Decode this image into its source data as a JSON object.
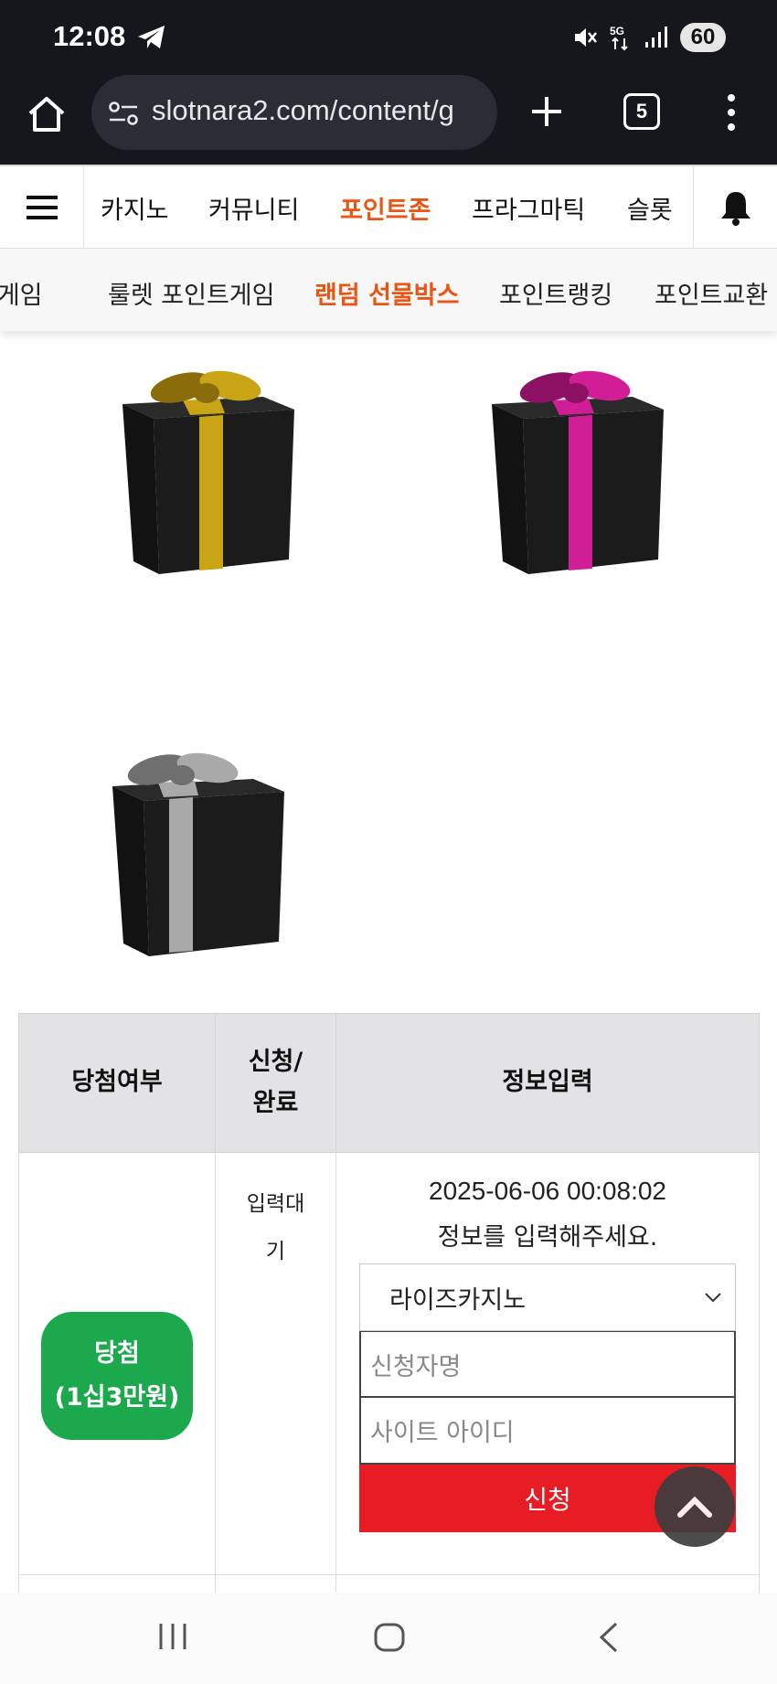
{
  "status_bar": {
    "time": "12:08",
    "battery": "60"
  },
  "browser": {
    "url": "slotnara2.com/content/g",
    "tab_count": "5"
  },
  "nav": {
    "items": [
      {
        "label": "카지노",
        "active": false
      },
      {
        "label": "커뮤니티",
        "active": false
      },
      {
        "label": "포인트존",
        "active": true
      },
      {
        "label": "프라그마틱",
        "active": false
      },
      {
        "label": "슬롯",
        "active": false
      }
    ]
  },
  "subnav": {
    "items": [
      {
        "label": "트게임",
        "active": false
      },
      {
        "label": "룰렛 포인트게임",
        "active": false
      },
      {
        "label": "랜덤 선물박스",
        "active": true
      },
      {
        "label": "포인트랭킹",
        "active": false
      },
      {
        "label": "포인트교환",
        "active": false
      }
    ]
  },
  "gifts": [
    {
      "name": "gold",
      "ribbon": "#c9a516",
      "ribbon_dark": "#8a6d0a"
    },
    {
      "name": "magenta",
      "ribbon": "#d21e96",
      "ribbon_dark": "#8c1063"
    },
    {
      "name": "silver",
      "ribbon": "#a9a9a9",
      "ribbon_dark": "#6f6f6f"
    }
  ],
  "table": {
    "headers": {
      "result": "당첨여부",
      "status_line1": "신청/",
      "status_line2": "완료",
      "info": "정보입력"
    },
    "row": {
      "result_line1": "당첨",
      "result_line2": "(1십3만원)",
      "status": "입력대기",
      "datetime": "2025-06-06 00:08:02",
      "message": "정보를 입력해주세요.",
      "site_select": "라이즈카지노",
      "name_placeholder": "신청자명",
      "id_placeholder": "사이트 아이디",
      "submit": "신청"
    }
  },
  "colors": {
    "accent": "#ea5514",
    "win_badge": "#1ca94d",
    "submit": "#e71c24"
  }
}
